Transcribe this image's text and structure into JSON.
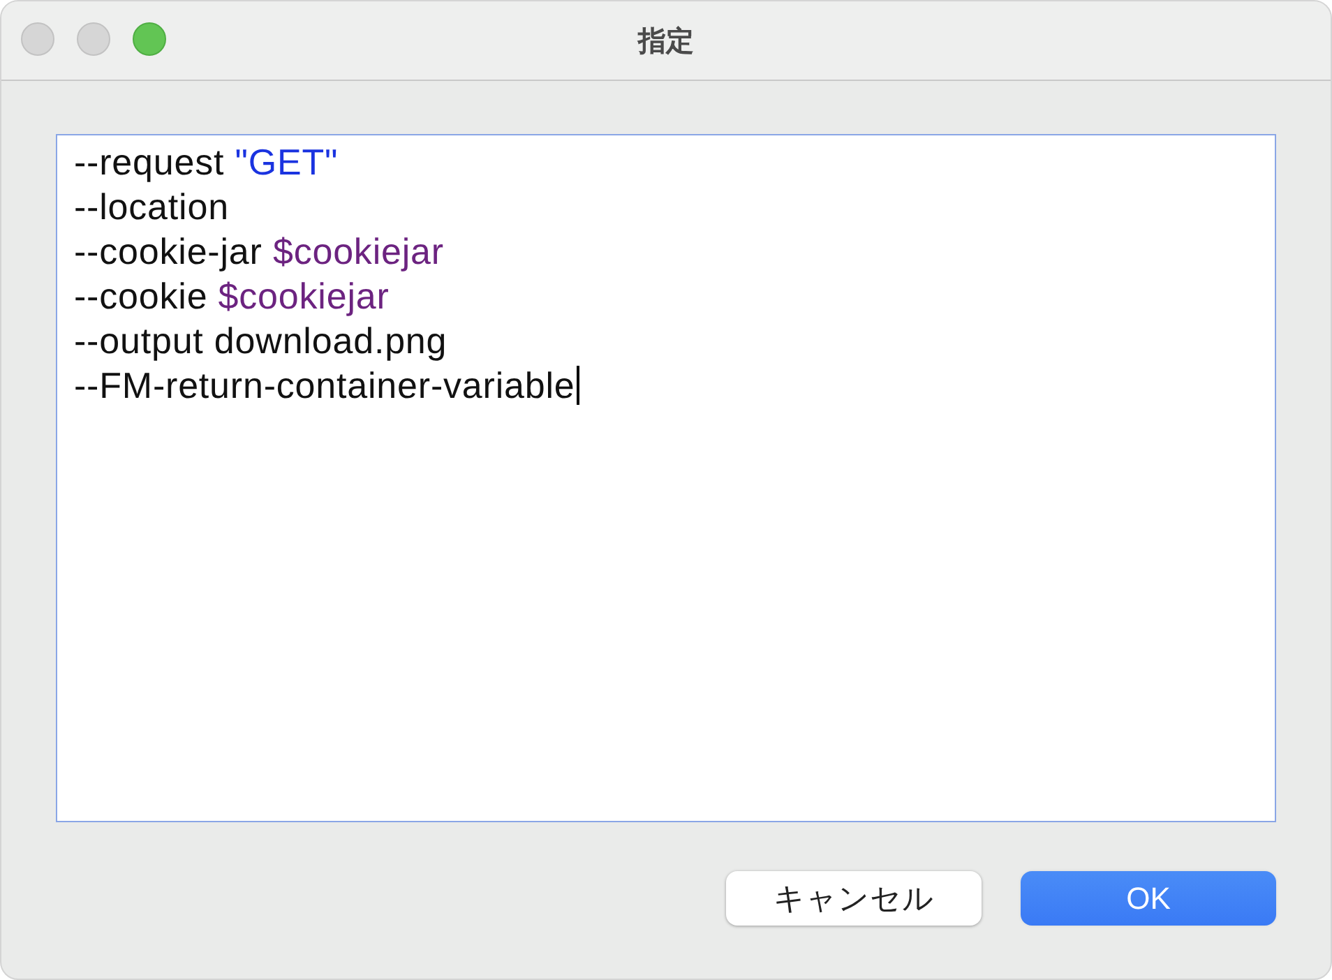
{
  "window": {
    "title": "指定",
    "controls": [
      {
        "kind": "close",
        "enabled": false
      },
      {
        "kind": "minimize",
        "enabled": false
      },
      {
        "kind": "zoom",
        "enabled": true
      }
    ]
  },
  "editor": {
    "lines": [
      {
        "caret": false,
        "segments": [
          {
            "kind": "plain",
            "text": "--request "
          },
          {
            "kind": "string",
            "text": "\"GET\""
          }
        ]
      },
      {
        "caret": false,
        "segments": [
          {
            "kind": "plain",
            "text": "--location"
          }
        ]
      },
      {
        "caret": false,
        "segments": [
          {
            "kind": "plain",
            "text": "--cookie-jar "
          },
          {
            "kind": "variable",
            "text": "$cookiejar"
          }
        ]
      },
      {
        "caret": false,
        "segments": [
          {
            "kind": "plain",
            "text": "--cookie "
          },
          {
            "kind": "variable",
            "text": "$cookiejar"
          }
        ]
      },
      {
        "caret": false,
        "segments": [
          {
            "kind": "plain",
            "text": "--output download.png"
          }
        ]
      },
      {
        "caret": true,
        "segments": [
          {
            "kind": "plain",
            "text": "--FM-return-container-variable"
          }
        ]
      }
    ]
  },
  "buttons": [
    {
      "label": "キャンセル",
      "kind": "secondary"
    },
    {
      "label": "OK",
      "kind": "primary"
    }
  ]
}
